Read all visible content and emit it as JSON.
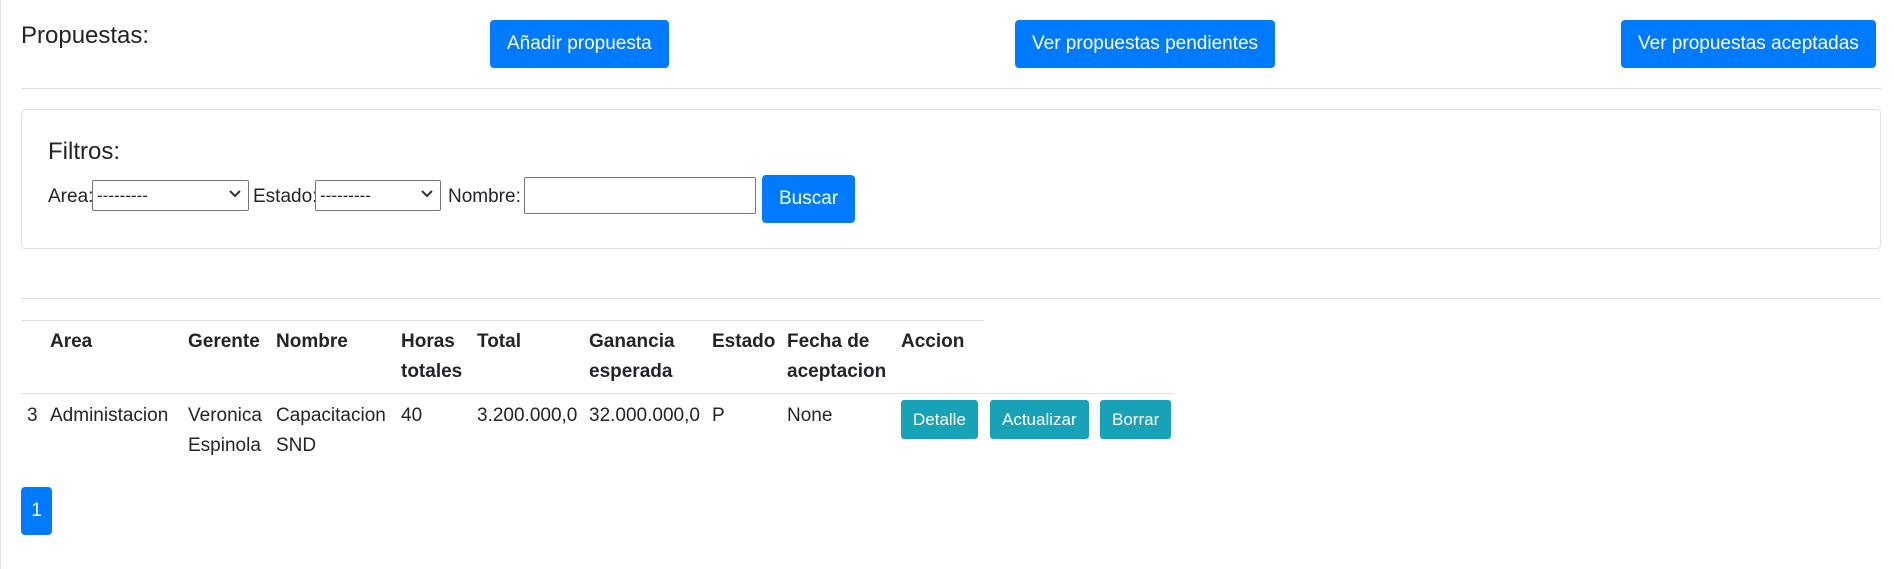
{
  "header": {
    "title": "Propuestas:",
    "add_button": "Añadir propuesta",
    "pending_button": "Ver propuestas pendientes",
    "accepted_button": "Ver propuestas aceptadas"
  },
  "filters": {
    "title": "Filtros:",
    "area_label": "Area:",
    "area_value": "---------",
    "estado_label": "Estado:",
    "estado_value": "---------",
    "nombre_label": "Nombre:",
    "nombre_value": "",
    "search_button": "Buscar"
  },
  "table": {
    "headers": [
      "Area",
      "Gerente",
      "Nombre",
      "Horas totales",
      "Total",
      "Ganancia esperada",
      "Estado",
      "Fecha de aceptacion",
      "Accion"
    ],
    "rows": [
      {
        "id": "3",
        "area": "Administacion",
        "gerente": "Veronica Espinola",
        "nombre": "Capacitacion SND",
        "horas": "40",
        "total": "3.200.000,0",
        "ganancia": "32.000.000,0",
        "estado": "P",
        "fecha": "None",
        "actions": [
          "Detalle",
          "Actualizar",
          "Borrar"
        ]
      }
    ]
  },
  "pagination": {
    "current_page": "1"
  },
  "colors": {
    "primary": "#007bff",
    "info": "#17a2b8",
    "border": "#dee2e6"
  }
}
